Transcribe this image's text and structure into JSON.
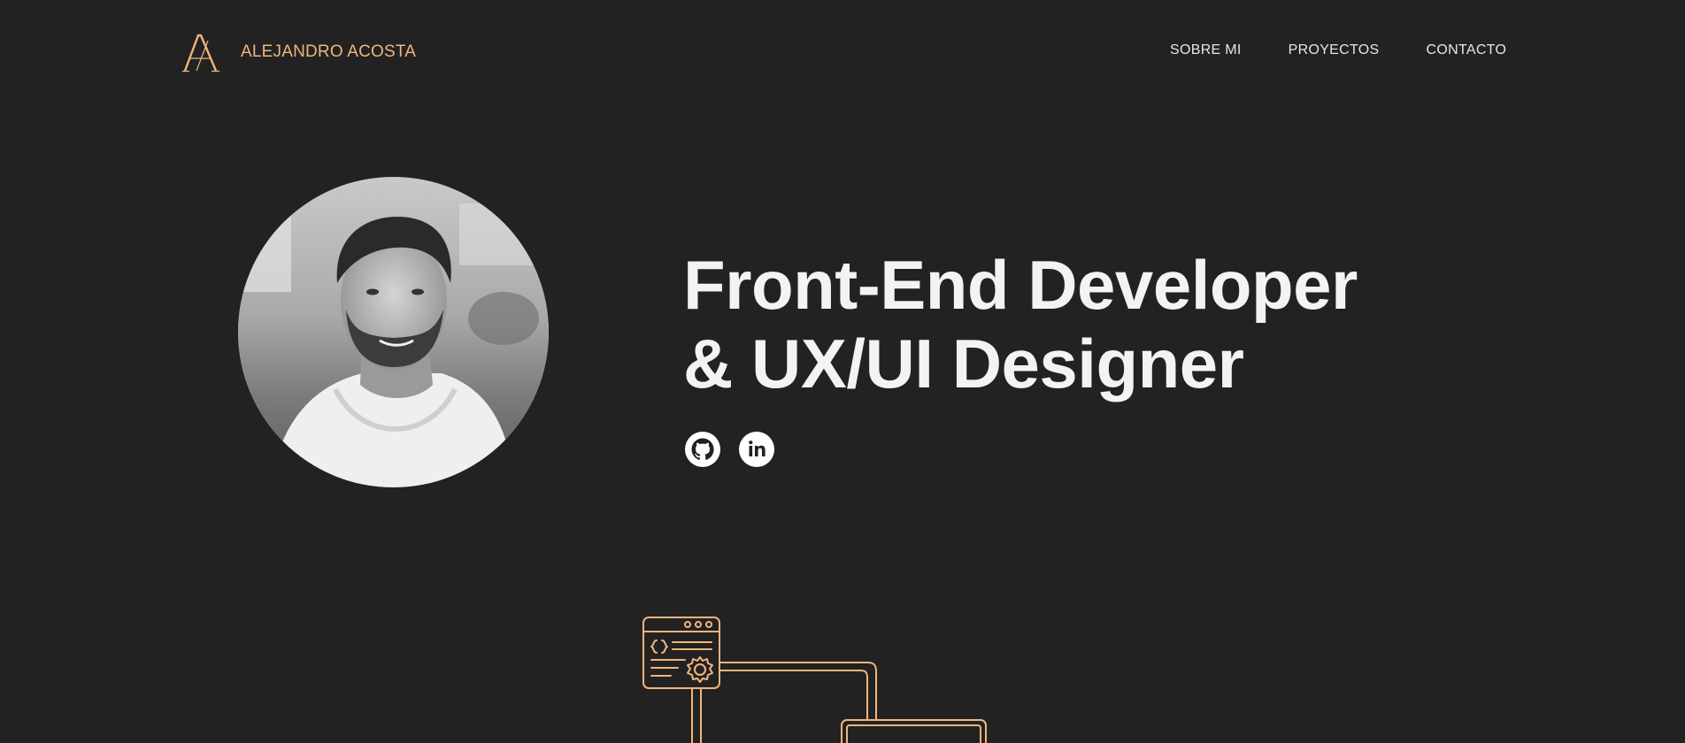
{
  "header": {
    "logo_icon": "monogram-a-logo",
    "brand_name": "ALEJANDRO ACOSTA",
    "nav": [
      {
        "label": "SOBRE MI"
      },
      {
        "label": "PROYECTOS"
      },
      {
        "label": "CONTACTO"
      }
    ]
  },
  "hero": {
    "avatar_icon": "profile-photo",
    "title_line1": "Front-End Developer",
    "title_line2": "& UX/UI Designer",
    "social": [
      {
        "icon": "github-icon"
      },
      {
        "icon": "linkedin-icon"
      }
    ]
  },
  "illustration": {
    "icon": "code-window-gear-illustration"
  },
  "colors": {
    "background": "#222222",
    "accent": "#f1b57c",
    "text": "#f3f3f3",
    "nav_text": "#e6e6e6"
  }
}
